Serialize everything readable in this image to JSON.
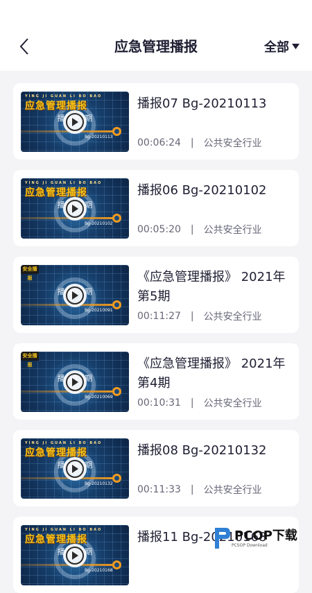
{
  "header": {
    "title": "应急管理播报",
    "filter_label": "全部"
  },
  "thumbnail": {
    "banner_text": "应急管理播报",
    "banner_sub": "YING JI GUAN LI BO BAO",
    "tag_text": "安全播报"
  },
  "videos": [
    {
      "title": "播报07 Bg-20210113",
      "duration": "00:06:24",
      "category": "公共安全行业",
      "episode": "播报0 7期",
      "code": "Bg-20210113",
      "has_banner": true
    },
    {
      "title": "播报06 Bg-20210102",
      "duration": "00:05:20",
      "category": "公共安全行业",
      "episode": "播报0 6期",
      "code": "Bg-20210102",
      "has_banner": true
    },
    {
      "title": "《应急管理播报》 2021年第5期",
      "duration": "00:11:27",
      "category": "公共安全行业",
      "episode": "播报0 5期",
      "code": "Bg-20210091",
      "has_banner": false
    },
    {
      "title": "《应急管理播报》 2021年第4期",
      "duration": "00:10:31",
      "category": "公共安全行业",
      "episode": "播报0 4期",
      "code": "Bg-20210069",
      "has_banner": false
    },
    {
      "title": "播报08 Bg-20210132",
      "duration": "00:11:33",
      "category": "公共安全行业",
      "episode": "播报0 8期",
      "code": "Bg-20210132",
      "has_banner": true
    },
    {
      "title": "播报11 Bg-20210168",
      "duration": "",
      "category": "",
      "episode": "播报1 1期",
      "code": "Bg-20210168",
      "has_banner": true
    }
  ],
  "meta_separator": "|",
  "watermark": {
    "text": "PCOP下载",
    "sub": "PCSOP Download"
  }
}
